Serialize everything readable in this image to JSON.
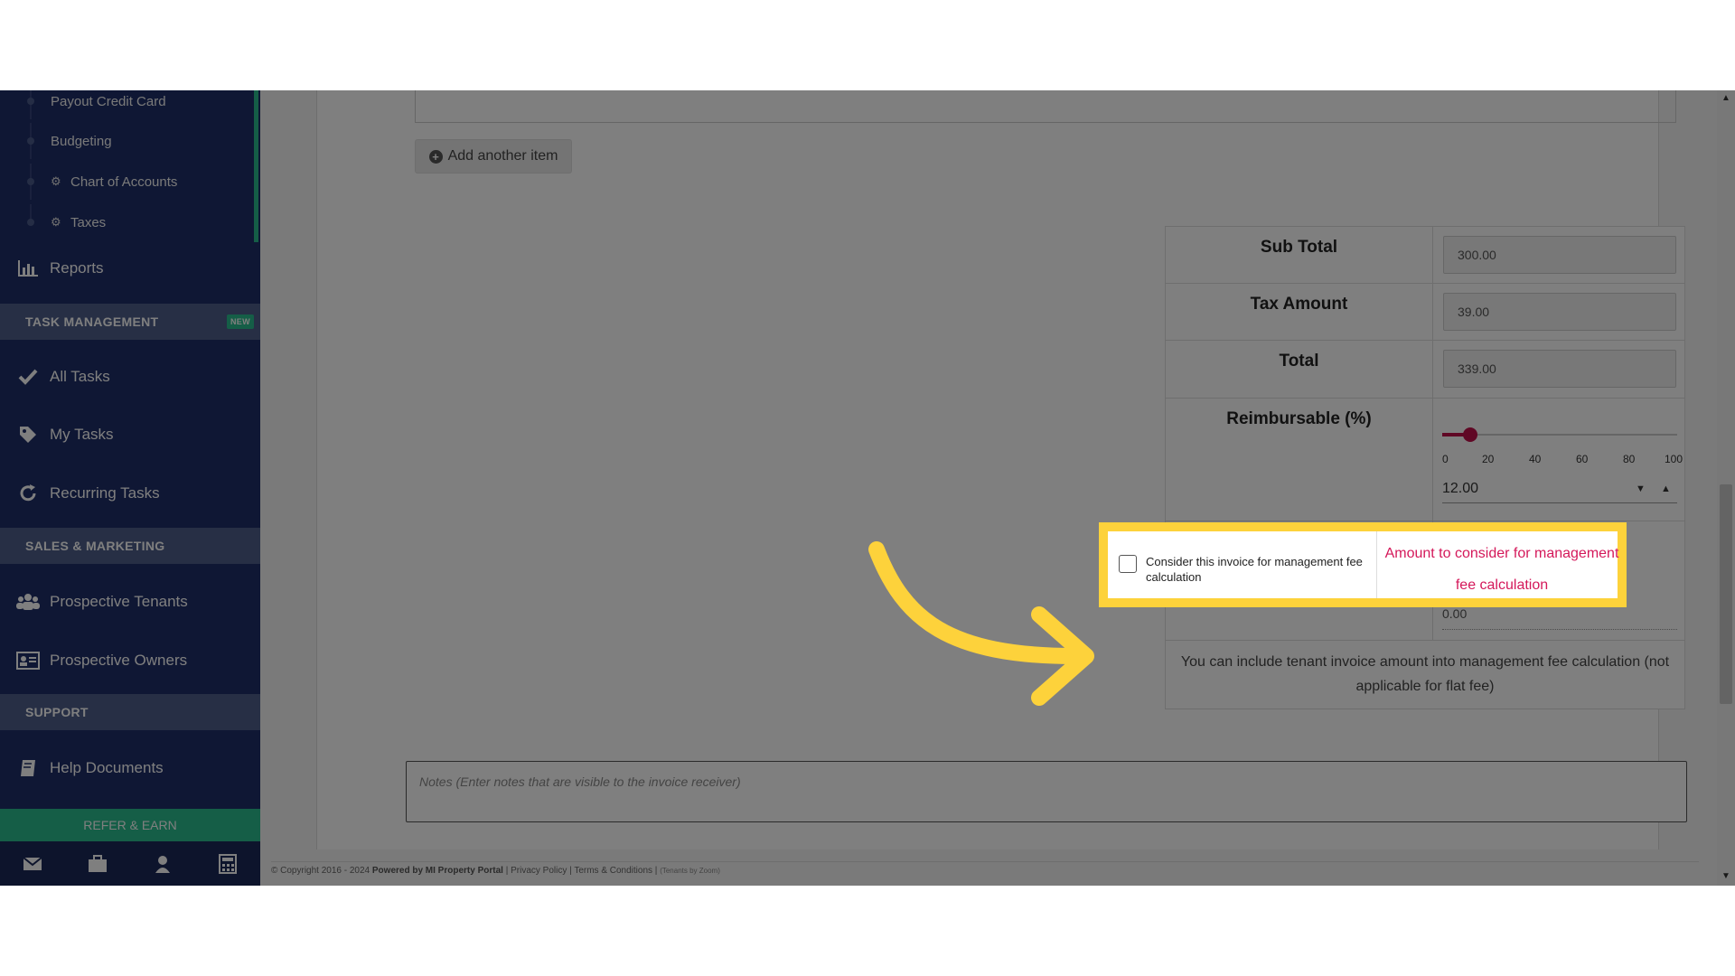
{
  "sidebar": {
    "sub_items": [
      {
        "label": "Payout Credit Card"
      },
      {
        "label": "Budgeting"
      },
      {
        "label": "Chart of Accounts"
      },
      {
        "label": "Taxes"
      }
    ],
    "reports": {
      "label": "Reports",
      "icon": "bar-chart-icon"
    },
    "task_management": {
      "header": "TASK MANAGEMENT",
      "badge": "NEW"
    },
    "tasks": [
      {
        "label": "All Tasks",
        "icon": "check-icon"
      },
      {
        "label": "My Tasks",
        "icon": "tag-icon"
      },
      {
        "label": "Recurring Tasks",
        "icon": "refresh-icon"
      }
    ],
    "sales_marketing": {
      "header": "SALES & MARKETING"
    },
    "prospects": [
      {
        "label": "Prospective Tenants",
        "icon": "users-icon"
      },
      {
        "label": "Prospective Owners",
        "icon": "id-card-icon"
      }
    ],
    "support": {
      "header": "SUPPORT"
    },
    "help": {
      "label": "Help Documents",
      "icon": "book-icon"
    },
    "refer_earn": "REFER & EARN",
    "bottom_icons": [
      "mail-icon",
      "briefcase-icon",
      "user-icon",
      "calculator-icon"
    ]
  },
  "main": {
    "add_item_label": "Add another item",
    "totals": {
      "sub_total": {
        "label": "Sub Total",
        "value": "300.00"
      },
      "tax_amount": {
        "label": "Tax Amount",
        "value": "39.00"
      },
      "total": {
        "label": "Total",
        "value": "339.00"
      },
      "reimbursable": {
        "label": "Reimbursable (%)",
        "value": "12.00",
        "fraction": 0.12,
        "ticks": [
          "0",
          "20",
          "40",
          "60",
          "80",
          "100"
        ]
      },
      "mgmt_fee": {
        "checkbox_label": "Consider this invoice for management fee calculation",
        "amount_label": "Amount to consider for management fee calculation",
        "amount_value": "0.00",
        "checked": false
      },
      "help_text": "You can include tenant invoice amount into management fee calculation (not applicable for flat fee)"
    },
    "notes_placeholder": "Notes (Enter notes that are visible to the invoice receiver)"
  },
  "footer": {
    "copyright": "© Copyright 2016 - 2024",
    "powered_by": "Powered by MI Property Portal",
    "privacy": "Privacy Policy",
    "terms": "Terms & Conditions",
    "small": "(Tenants by Zoom)"
  },
  "colors": {
    "sidebar_bg": "#1f2f68",
    "accent_green": "#2bbd8e",
    "slider_accent": "#c0104a",
    "highlight_yellow": "#fdd23b",
    "link_pink": "#d4185a"
  }
}
